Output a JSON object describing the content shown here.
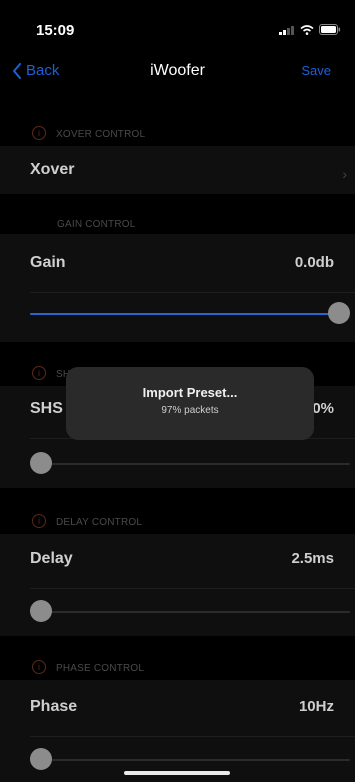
{
  "status_bar": {
    "time": "15:09"
  },
  "nav": {
    "back_label": "Back",
    "title": "iWoofer",
    "save_label": "Save"
  },
  "sections": {
    "xover": {
      "header": "XOVER CONTROL",
      "row_label": "Xover"
    },
    "gain": {
      "header": "GAIN CONTROL",
      "row_label": "Gain",
      "value": "0.0db",
      "slider_fraction": 1.0
    },
    "shs": {
      "header": "SHS CONTROL",
      "row_label": "SHS",
      "value": "0%",
      "slider_fraction": 0.0
    },
    "delay": {
      "header": "DELAY CONTROL",
      "row_label": "Delay",
      "value": "2.5ms",
      "slider_fraction": 0.0
    },
    "phase": {
      "header": "PHASE CONTROL",
      "row_label": "Phase",
      "value": "10Hz",
      "slider_fraction": 0.0
    }
  },
  "hud": {
    "title": "Import Preset...",
    "subtitle": "97% packets",
    "progress_percent": 97
  },
  "colors": {
    "accent": "#1f5fd6",
    "slider_fill": "#2a66cf",
    "thumb": "#8c8c8c",
    "info_icon": "#5a2a16"
  }
}
